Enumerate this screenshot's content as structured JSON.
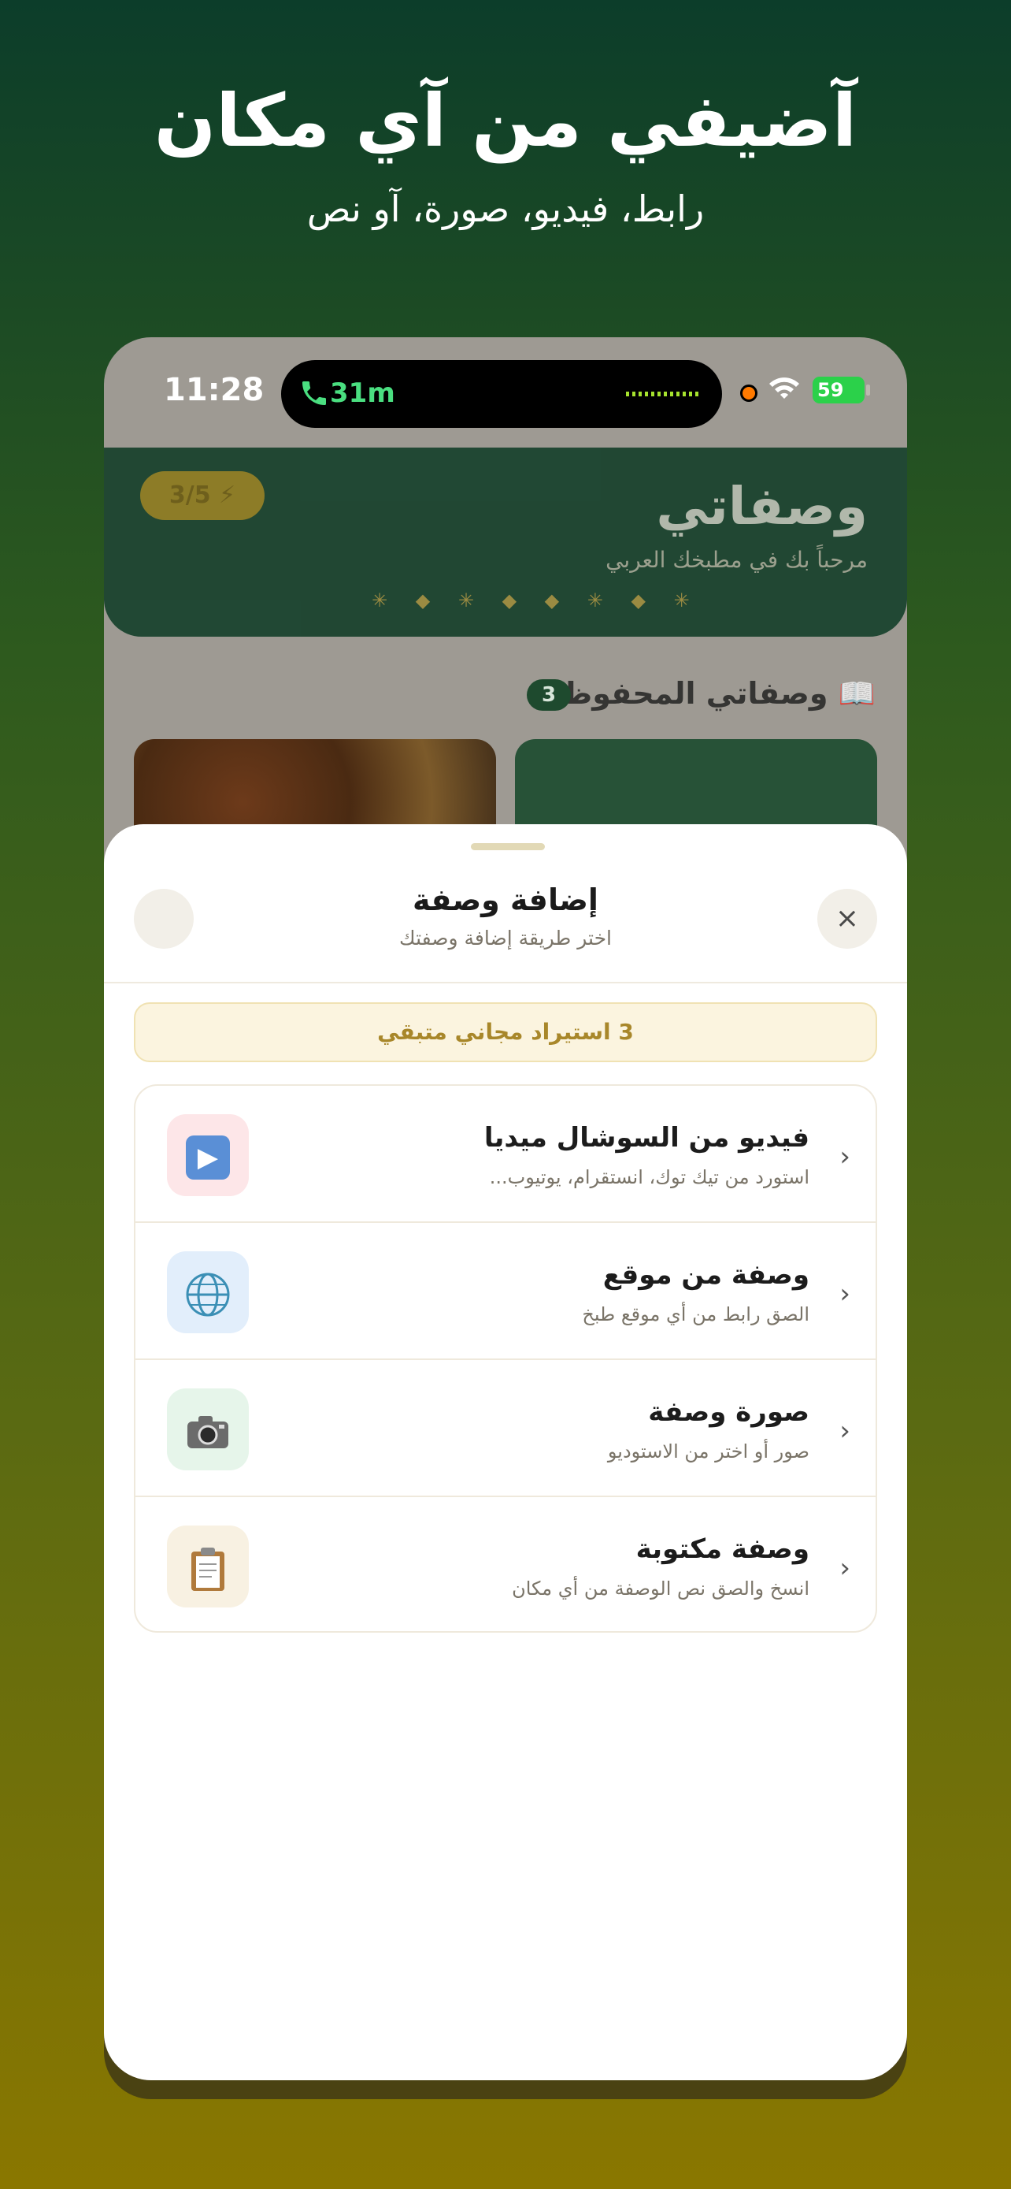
{
  "hero": {
    "title": "آضيفي من آي مكان",
    "subtitle": "رابط، فيديو، صورة، آو نص"
  },
  "status_bar": {
    "time": "11:28",
    "call_duration": "31m",
    "battery": "59"
  },
  "app": {
    "title": "وصفاتي",
    "subtitle": "مرحباً بك في مطبخك العربي",
    "quota": "3/5",
    "dots": "✳ ◆ ✳ ◆ ◆ ✳ ◆ ✳"
  },
  "saved": {
    "title": "📖 وصفاتي المحفوظة",
    "count": "3"
  },
  "sheet": {
    "title": "إضافة وصفة",
    "subtitle": "اختر طريقة إضافة وصفتك",
    "close_icon": "×",
    "free_banner": "3 استيراد مجاني متبقي",
    "options": [
      {
        "title": "فيديو من السوشال ميديا",
        "desc": "استورد من تيك توك، انستقرام، يوتيوب...",
        "icon": "▶",
        "icon_name": "video-play-icon",
        "icon_bg": "#fde6e8"
      },
      {
        "title": "وصفة من موقع",
        "desc": "الصق رابط من أي موقع طبخ",
        "icon": "🌐",
        "icon_name": "globe-icon",
        "icon_bg": "#e2eefb"
      },
      {
        "title": "صورة وصفة",
        "desc": "صور أو اختر من الاستوديو",
        "icon": "📷",
        "icon_name": "camera-icon",
        "icon_bg": "#e6f5ea"
      },
      {
        "title": "وصفة مكتوبة",
        "desc": "انسخ والصق نص الوصفة من أي مكان",
        "icon": "📋",
        "icon_name": "clipboard-icon",
        "icon_bg": "#f8f1e2"
      }
    ]
  }
}
